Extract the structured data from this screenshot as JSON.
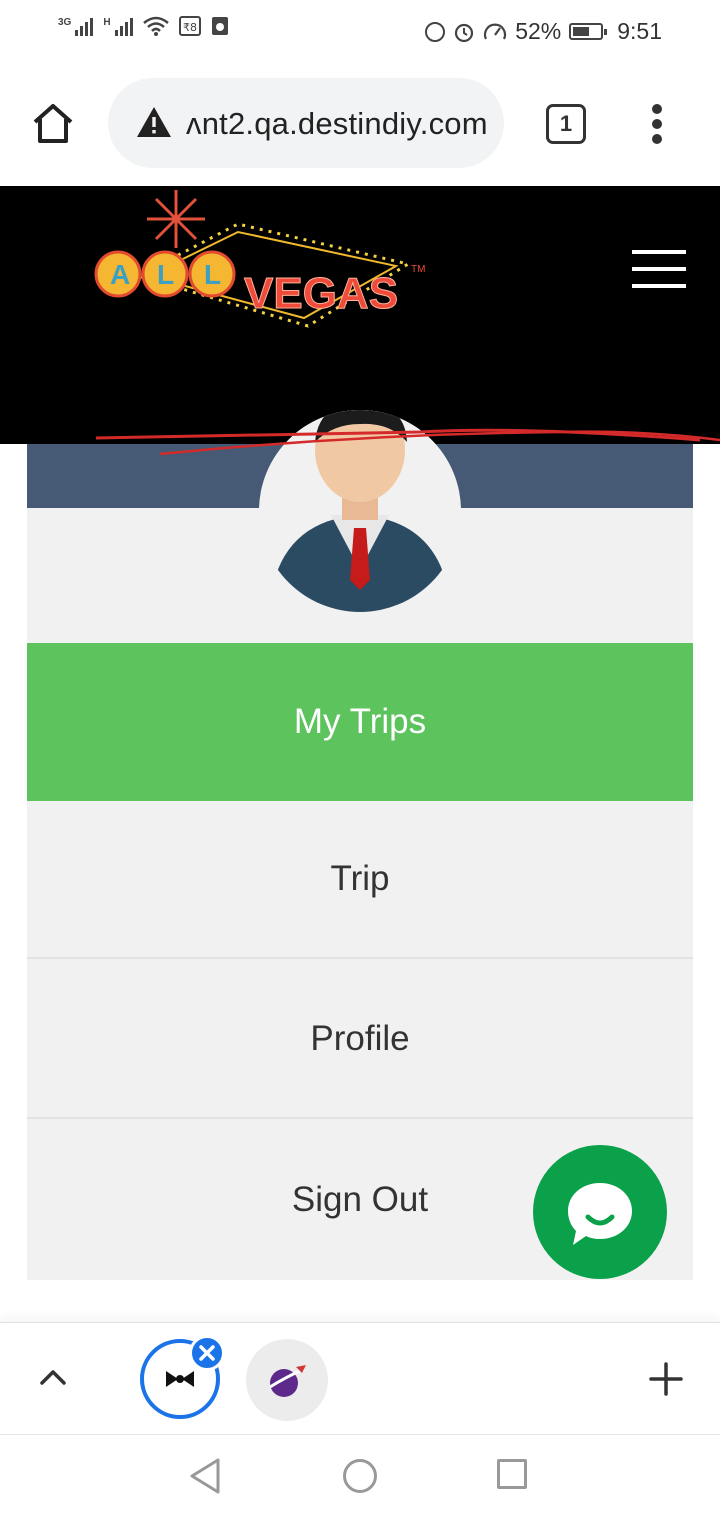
{
  "status_bar": {
    "network_1": "3G",
    "network_2": "H",
    "battery": "52%",
    "time": "9:51"
  },
  "browser": {
    "url": "ʌnt2.qa.destindiy.com",
    "tab_count": "1"
  },
  "site": {
    "logo_text_all": "ALL",
    "logo_text_vegas": "VEGAS",
    "logo_tm": "TM"
  },
  "menu": {
    "items": [
      {
        "label": "My Trips",
        "active": true
      },
      {
        "label": "Trip",
        "active": false
      },
      {
        "label": "Profile",
        "active": false
      },
      {
        "label": "Sign Out",
        "active": false
      }
    ]
  },
  "colors": {
    "header_bg": "#000000",
    "banner": "#465a75",
    "active_item": "#5cc35d",
    "chat_fab": "#0aa14a",
    "tab_accent": "#1a73e8"
  }
}
